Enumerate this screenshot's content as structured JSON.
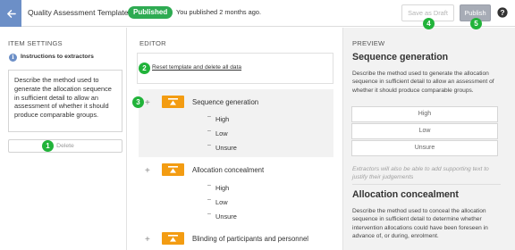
{
  "header": {
    "title": "Quality Assessment Template",
    "status_badge": "Published",
    "status_text": "You published 2 months ago.",
    "save_draft_label": "Save as Draft",
    "publish_label": "Publish",
    "icons": {
      "back": "arrow-left-icon",
      "help": "help-icon"
    }
  },
  "markers": [
    "1",
    "2",
    "3",
    "4",
    "5"
  ],
  "item_settings": {
    "heading": "ITEM SETTINGS",
    "instructions_label": "Instructions to extractors",
    "instructions_text": "Describe the method used to generate the allocation sequence in sufficient detail to allow an assessment of whether it should produce comparable groups.",
    "delete_label": "Delete"
  },
  "editor": {
    "heading": "EDITOR",
    "reset_link": "Reset template and delete all data",
    "questions": [
      {
        "label": "Sequence generation",
        "options": [
          "High",
          "Low",
          "Unsure"
        ]
      },
      {
        "label": "Allocation concealment",
        "options": [
          "High",
          "Low",
          "Unsure"
        ]
      },
      {
        "label": "Blinding of participants and personnel"
      }
    ]
  },
  "preview": {
    "heading": "PREVIEW",
    "q1_title": "Sequence generation",
    "q1_desc": "Describe the method used to generate the allocation sequence in sufficient detail to allow an assessment of whether it should produce comparable groups.",
    "q1_options": [
      "High",
      "Low",
      "Unsure"
    ],
    "hint": "Extractors will also be able to add supporting text to justify their judgements",
    "q2_title": "Allocation concealment",
    "q2_desc": "Describe the method used to conceal the allocation sequence in sufficient detail to determine whether intervention allocations could have been foreseen in advance of, or during, enrolment."
  },
  "colors": {
    "accent": "#6c8fc7",
    "published": "#2eab52",
    "marker": "#21b33a",
    "question_badge": "#f39c12"
  }
}
